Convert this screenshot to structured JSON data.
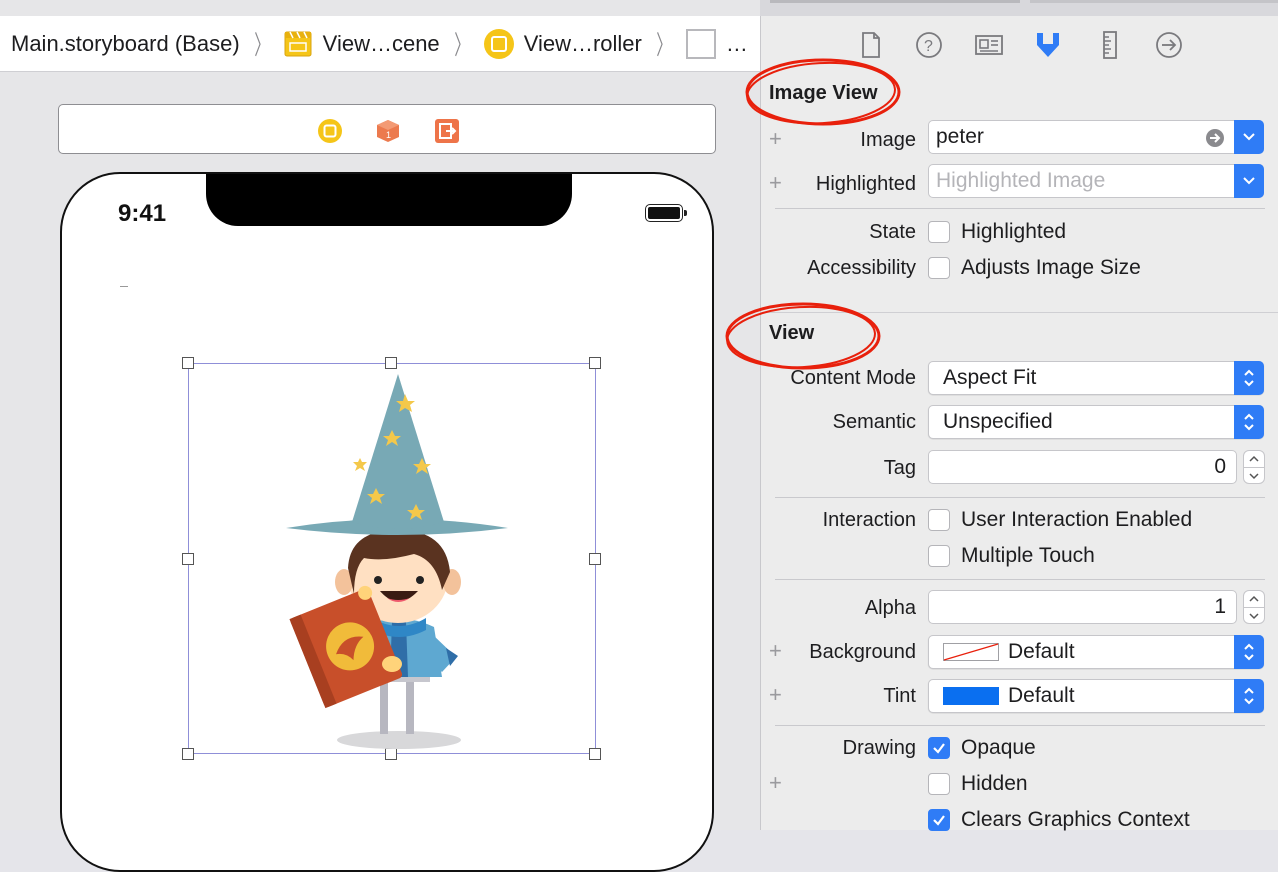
{
  "breadcrumb": {
    "items": [
      "Main.storyboard (Base)",
      "View…cene",
      "View…roller",
      "…"
    ]
  },
  "canvas": {
    "status_time": "9:41"
  },
  "inspector": {
    "tabs": [
      "file-icon",
      "help-icon",
      "identity-icon",
      "attributes-icon",
      "size-icon",
      "connections-icon"
    ],
    "image_view": {
      "header": "Image View",
      "image_label": "Image",
      "image_value": "peter",
      "highlighted_label": "Highlighted",
      "highlighted_placeholder": "Highlighted Image",
      "state_label": "State",
      "state_option": "Highlighted",
      "accessibility_label": "Accessibility",
      "accessibility_option": "Adjusts Image Size"
    },
    "view": {
      "header": "View",
      "content_mode_label": "Content Mode",
      "content_mode_value": "Aspect Fit",
      "semantic_label": "Semantic",
      "semantic_value": "Unspecified",
      "tag_label": "Tag",
      "tag_value": "0",
      "interaction_label": "Interaction",
      "user_interaction_option": "User Interaction Enabled",
      "multiple_touch_option": "Multiple Touch",
      "alpha_label": "Alpha",
      "alpha_value": "1",
      "background_label": "Background",
      "background_value": "Default",
      "tint_label": "Tint",
      "tint_value": "Default",
      "drawing_label": "Drawing",
      "opaque_option": "Opaque",
      "hidden_option": "Hidden",
      "clears_option": "Clears Graphics Context",
      "opaque_checked": true,
      "hidden_checked": false,
      "clears_checked": true
    }
  },
  "colors": {
    "accent": "#2f7cf6",
    "annotation": "#e8200c",
    "tint_swatch": "#0a6ff0"
  }
}
